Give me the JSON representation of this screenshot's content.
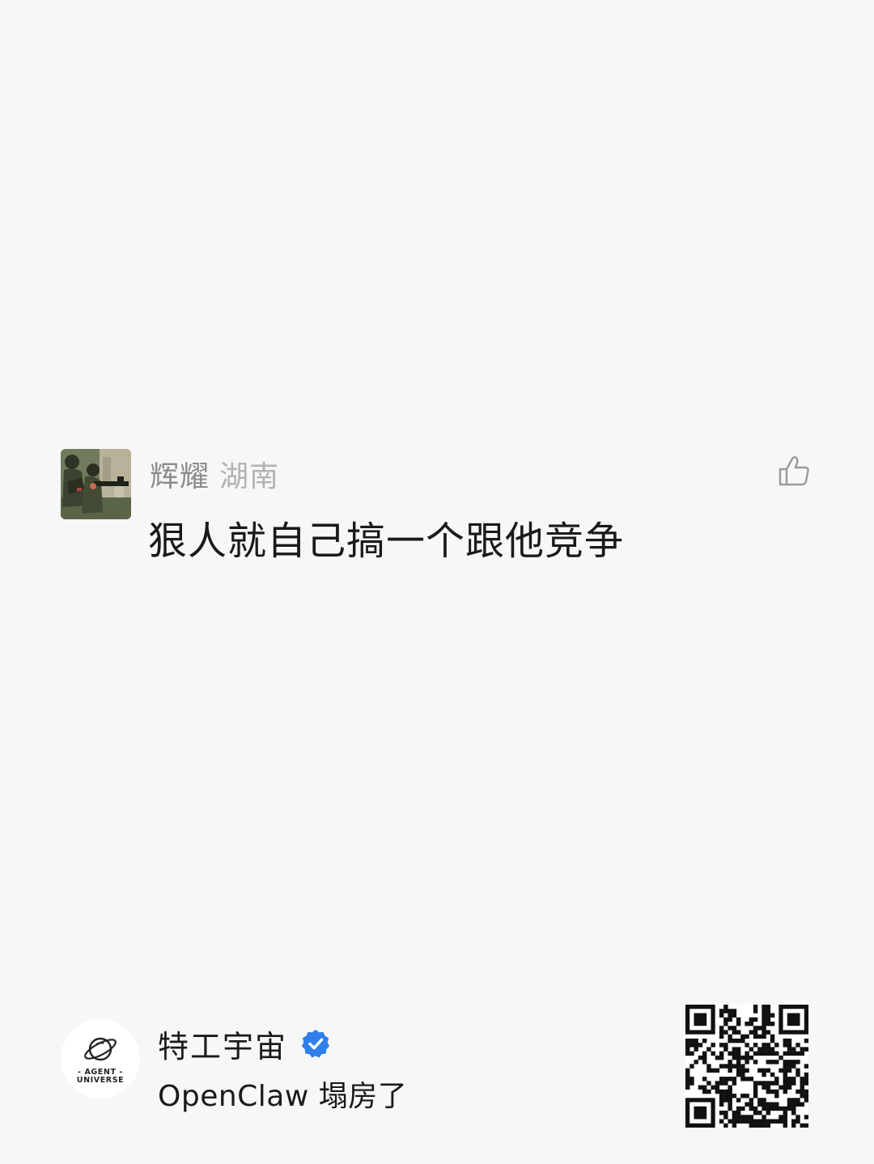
{
  "comment": {
    "author": "辉耀",
    "location": "湖南",
    "text": "狠人就自己搞一个跟他竞争",
    "avatar_icon": "soldiers-photo-avatar",
    "like_icon": "thumbs-up-icon"
  },
  "account": {
    "logo_text_line1": "- AGENT -",
    "logo_text_line2": "UNIVERSE",
    "name": "特工宇宙",
    "verified_icon": "verified-check-icon",
    "verified_color": "#2f7fec",
    "article_title": "OpenClaw 塌房了",
    "qr_icon": "qr-code"
  },
  "colors": {
    "background": "#f7f7f7",
    "author": "#8c8c8c",
    "location": "#b3b3b3",
    "text": "#1a1a1a"
  }
}
